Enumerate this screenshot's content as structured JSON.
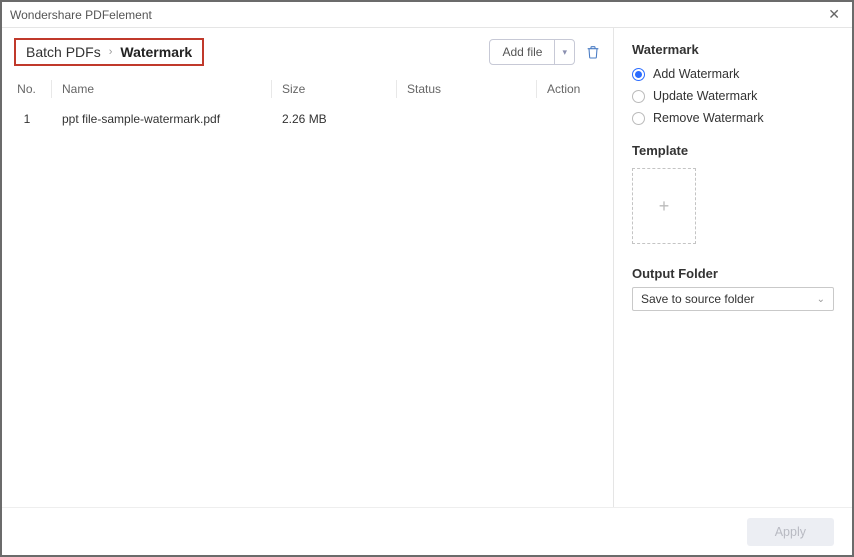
{
  "window": {
    "title": "Wondershare PDFelement"
  },
  "breadcrumb": {
    "root": "Batch PDFs",
    "current": "Watermark"
  },
  "toolbar": {
    "add_file_label": "Add file"
  },
  "table": {
    "headers": {
      "no": "No.",
      "name": "Name",
      "size": "Size",
      "status": "Status",
      "action": "Action"
    },
    "rows": [
      {
        "no": "1",
        "name": "ppt file-sample-watermark.pdf",
        "size": "2.26 MB",
        "status": "",
        "action": ""
      }
    ]
  },
  "sidebar": {
    "watermark_title": "Watermark",
    "options": {
      "add": "Add Watermark",
      "update": "Update Watermark",
      "remove": "Remove Watermark"
    },
    "template_title": "Template",
    "output_title": "Output Folder",
    "output_value": "Save to source folder"
  },
  "footer": {
    "apply_label": "Apply"
  }
}
